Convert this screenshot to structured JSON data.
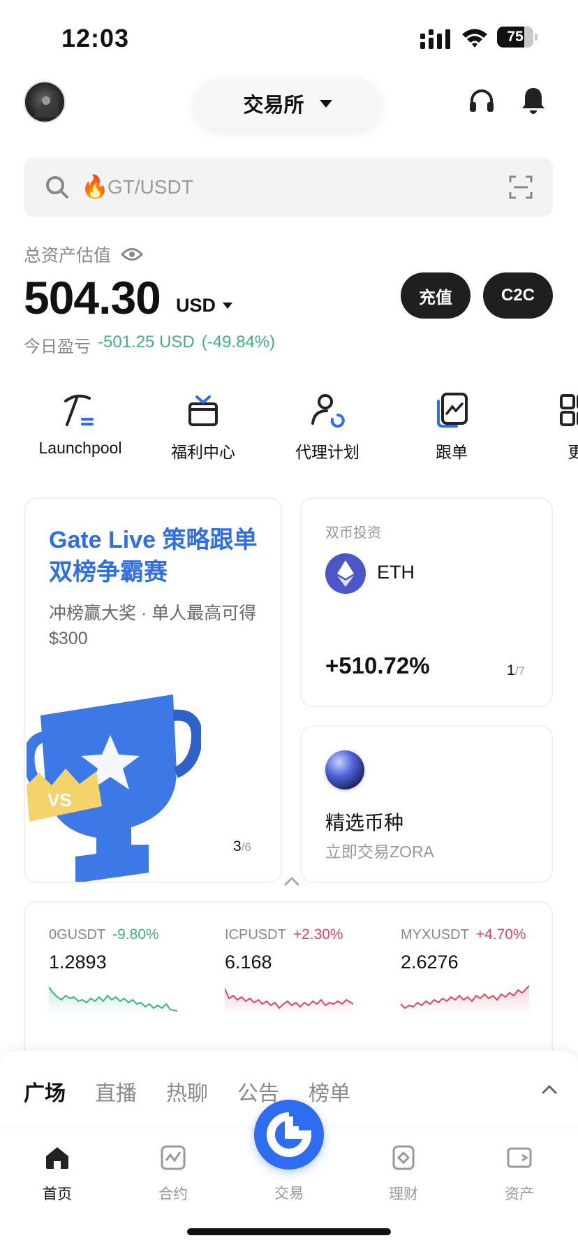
{
  "status_bar": {
    "time": "12:03",
    "battery": "75"
  },
  "header": {
    "exchange_label": "交易所"
  },
  "search": {
    "emoji": "🔥",
    "placeholder": "GT/USDT"
  },
  "assets": {
    "label": "总资产估值",
    "value": "504.30",
    "unit": "USD",
    "pnl_label": "今日盈亏",
    "pnl_value": "-501.25 USD",
    "pnl_pct": "(-49.84%)",
    "deposit_label": "充值",
    "c2c_label": "C2C"
  },
  "shortcuts": [
    {
      "label": "Launchpool",
      "icon": "pickaxe-icon"
    },
    {
      "label": "福利中心",
      "icon": "gift-icon"
    },
    {
      "label": "代理计划",
      "icon": "agent-icon"
    },
    {
      "label": "跟单",
      "icon": "copy-trade-icon"
    },
    {
      "label": "更",
      "icon": "more-icon"
    }
  ],
  "promo": {
    "title": "Gate Live 策略跟单双榜争霸赛",
    "subtitle": "冲榜赢大奖 · 单人最高可得 $300",
    "badge": "VS",
    "page": "3",
    "total": "/6"
  },
  "dual_invest": {
    "label": "双币投资",
    "coin": "ETH",
    "pct": "+510.72%",
    "page": "1",
    "total": "/7"
  },
  "featured": {
    "title": "精选币种",
    "subtitle": "立即交易ZORA"
  },
  "tickers": [
    {
      "pair": "0GUSDT",
      "change": "-9.80%",
      "price": "1.2893",
      "direction": "down",
      "color": "#3fb27f"
    },
    {
      "pair": "ICPUSDT",
      "change": "+2.30%",
      "price": "6.168",
      "direction": "up",
      "color": "#e1455d"
    },
    {
      "pair": "MYXUSDT",
      "change": "+4.70%",
      "price": "2.6276",
      "direction": "up",
      "color": "#e1455d"
    }
  ],
  "sheet_tabs": [
    "广场",
    "直播",
    "热聊",
    "公告",
    "榜单"
  ],
  "nav": {
    "home": "首页",
    "futures": "合约",
    "trade": "交易",
    "earn": "理财",
    "assets": "资产"
  },
  "colors": {
    "accent": "#2e6cf0",
    "up": "#e1455d",
    "down": "#3fb27f"
  }
}
